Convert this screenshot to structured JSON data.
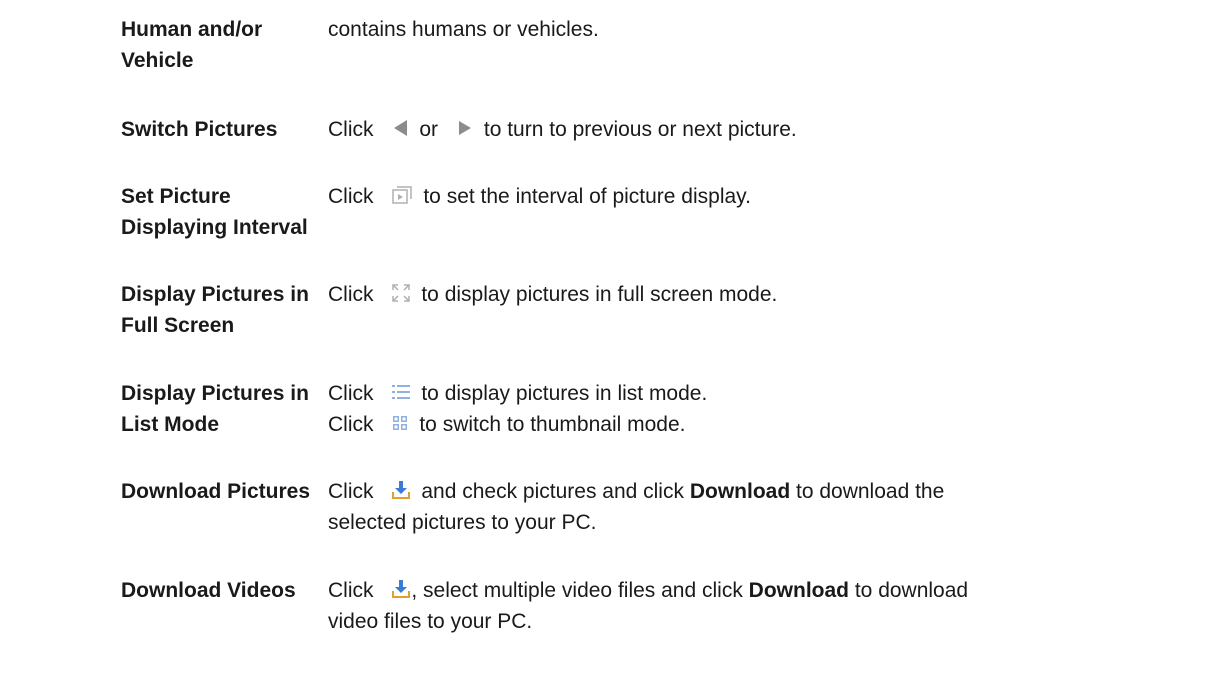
{
  "rows": [
    {
      "term_lines": [
        "Human and/or",
        "Vehicle"
      ],
      "desc": {
        "text": "contains humans or vehicles."
      }
    },
    {
      "term_lines": [
        "Switch Pictures"
      ],
      "desc": {
        "click": "Click",
        "or": "or",
        "rest": "to turn to previous or next picture.",
        "icons": [
          "previous-icon",
          "next-icon"
        ]
      }
    },
    {
      "term_lines": [
        "Set Picture",
        "Displaying Interval"
      ],
      "desc": {
        "click": "Click",
        "rest": "to set the interval of picture display.",
        "icons": [
          "slideshow-interval-icon"
        ]
      }
    },
    {
      "term_lines": [
        "Display Pictures in",
        "Full Screen"
      ],
      "desc": {
        "click": "Click",
        "rest": "to display pictures in full screen mode.",
        "icons": [
          "fullscreen-icon"
        ]
      }
    },
    {
      "term_lines": [
        "Display Pictures in",
        "List Mode"
      ],
      "desc": {
        "line1": {
          "click": "Click",
          "rest": "to display pictures in list mode.",
          "icon": "list-mode-icon"
        },
        "line2": {
          "click": "Click",
          "rest": "to switch to thumbnail mode.",
          "icon": "thumbnail-mode-icon"
        }
      }
    },
    {
      "term_lines": [
        "Download Pictures"
      ],
      "desc": {
        "click": "Click",
        "part1": "and check pictures and click",
        "bold": "Download",
        "part2": "to download the",
        "line2": "selected pictures to your PC.",
        "icons": [
          "download-icon"
        ]
      }
    },
    {
      "term_lines": [
        "Download Videos"
      ],
      "desc": {
        "click": "Click",
        "after_icon": ", select multiple video files and click",
        "bold": "Download",
        "part2": "to download",
        "line2": "video files to your PC.",
        "icons": [
          "download-icon"
        ]
      }
    }
  ],
  "colors": {
    "text": "#1a1a1a",
    "icon_gray": "#9a9a9a",
    "icon_light": "#b8b8b8",
    "download_blue": "#3a7bd5"
  }
}
